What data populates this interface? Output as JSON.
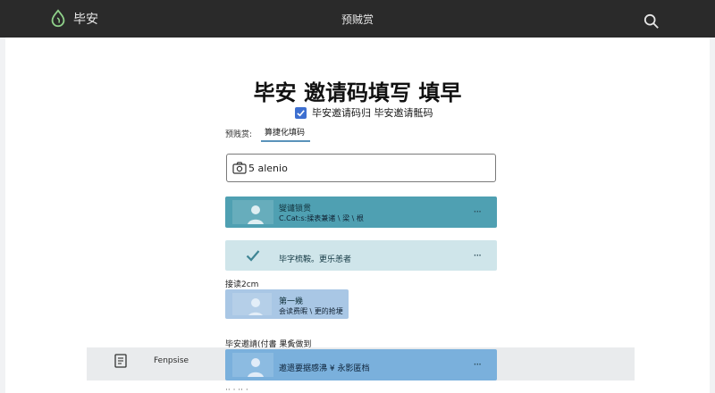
{
  "topbar": {
    "brand": "毕安",
    "title": "预贼赏",
    "icons": {
      "logo": "drop-leaf-logo",
      "search": "search-icon"
    },
    "background": "#2a2a2a"
  },
  "main": {
    "heading": "毕安 邀请码填写 填早",
    "agreement": {
      "checked": true,
      "text": "毕安邀请码归  毕安邀请骶码"
    },
    "tabs": {
      "label": "预贱赏:",
      "active": "算捷化填码"
    },
    "input": {
      "value": "5 alenio"
    },
    "cards": [
      {
        "title": "燮谴锁贯",
        "subtitle": "C.Cat:s:揉表兼诸 \\ 梁 \\ 根",
        "more": "···",
        "color": "#4fa0b2"
      },
      {
        "title": "毕字梳鞍。更乐恙者",
        "more": "···",
        "color": "#cfe5ea"
      },
      {
        "title": "第一幾",
        "subtitle": "会读费暇 \\ 更的抢埂",
        "color": "#a9c7e5"
      },
      {
        "title": "邀遗要据感沸 ¥ 永影匿档",
        "more": "···",
        "color": "#7ab0dc"
      }
    ],
    "label_a": "接读2cm",
    "label_b": "毕安邀請(付書   果夤做到",
    "side": {
      "text": "Fenpsise",
      "icon": "document-icon"
    },
    "bottom_fragment": "  ··    ·   ··  ·"
  },
  "colors": {
    "accent": "#3d6fd0",
    "tab_underline": "#5a93ba"
  }
}
